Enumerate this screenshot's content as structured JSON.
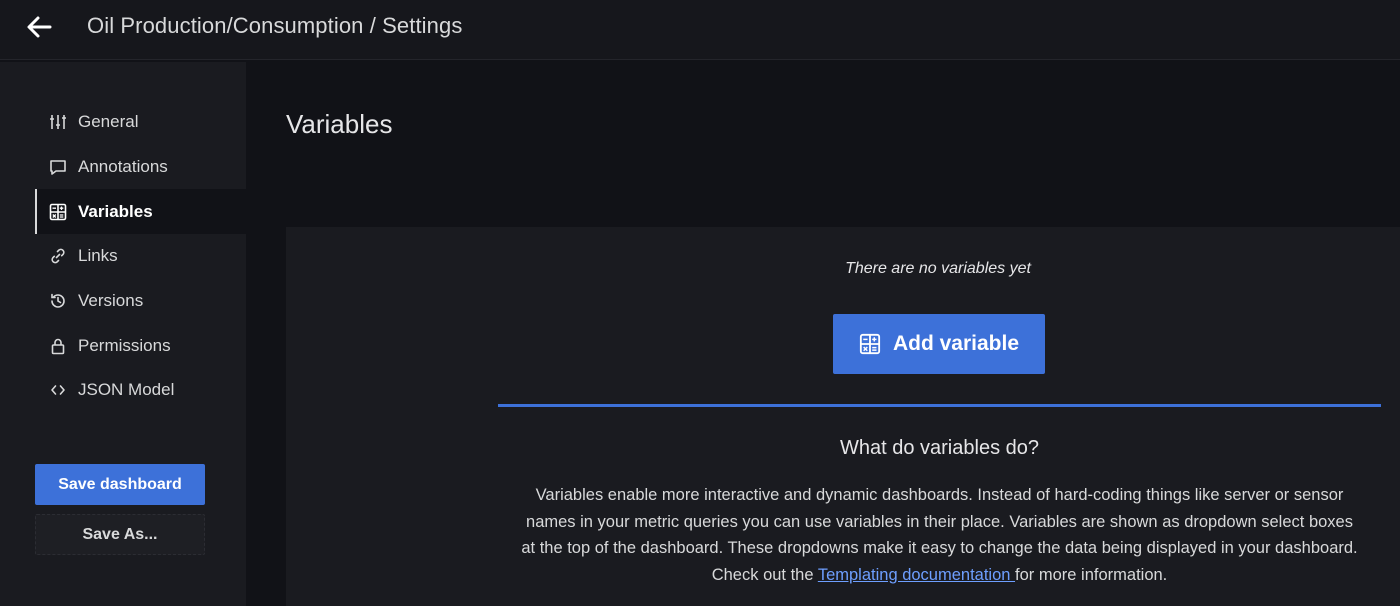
{
  "header": {
    "title": "Oil Production/Consumption / Settings",
    "back_icon": "arrow-left-icon"
  },
  "sidebar": {
    "items": [
      {
        "label": "General",
        "icon": "sliders-icon"
      },
      {
        "label": "Annotations",
        "icon": "comment-icon"
      },
      {
        "label": "Variables",
        "icon": "calculator-icon",
        "active": true
      },
      {
        "label": "Links",
        "icon": "link-icon"
      },
      {
        "label": "Versions",
        "icon": "history-icon"
      },
      {
        "label": "Permissions",
        "icon": "lock-icon"
      },
      {
        "label": "JSON Model",
        "icon": "code-icon"
      }
    ],
    "save_label": "Save dashboard",
    "save_as_label": "Save As..."
  },
  "main": {
    "heading": "Variables",
    "empty_text": "There are no variables yet",
    "add_label": "Add variable",
    "help_title": "What do variables do?",
    "help_text_before": "Variables enable more interactive and dynamic dashboards. Instead of hard-coding things like server or sensor names in your metric queries you can use variables in their place. Variables are shown as dropdown select boxes at the top of the dashboard. These dropdowns make it easy to change the data being displayed in your dashboard. Check out the ",
    "help_link": "Templating documentation ",
    "help_text_after": "for more information."
  },
  "colors": {
    "accent": "#3d71d9",
    "background": "#111217",
    "panel": "#1a1b20",
    "link": "#6e9fff"
  }
}
